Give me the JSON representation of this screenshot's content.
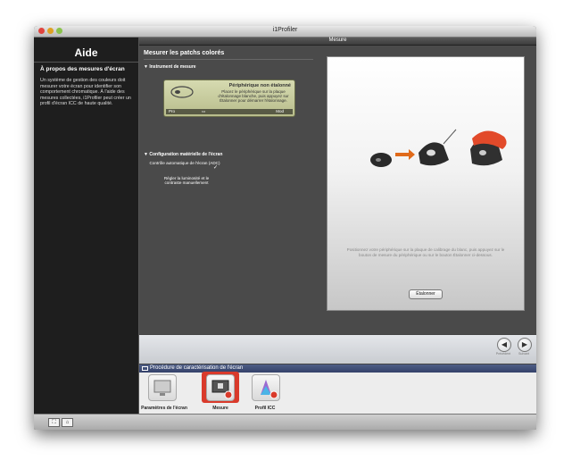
{
  "window": {
    "title": "i1Profiler"
  },
  "sidebar": {
    "title": "Aide",
    "heading": "À propos des mesures d'écran",
    "text": "Un système de gestion des couleurs doit mesurer votre écran pour identifier son comportement chromatique. À l'aide des mesures collectées, i1Profiler peut créer un profil d'écran ICC de haute qualité."
  },
  "main": {
    "header": "Mesure",
    "section_title": "Mesurer les patchs colorés",
    "instrument_heading": "Instrument de mesure",
    "device": {
      "status": "Périphérique non étalonné",
      "description": "Placez le périphérique sur la plaque d'étalonnage blanche, puis appuyez sur Étalonner pour démarrer l'étalonnage.",
      "bar_left": "Pro",
      "bar_right": "Mod"
    },
    "config_heading": "Configuration matérielle de l'écran",
    "adc_label": "Contrôle automatique de l'écran (ADC)",
    "adc_checked": "✓",
    "manual_label": "Régler la luminosité et le contraste manuellement",
    "manual_checked": "",
    "instructions": "Positionnez votre périphérique sur la plaque de calibrage du blanc, puis appuyez sur le bouton de mesure du périphérique ou sur le bouton Étalonner ci-dessous.",
    "calibrate_button": "Étalonner"
  },
  "nav": {
    "prev_label": "Précédent",
    "next_label": "Suivant"
  },
  "procedure": {
    "title": "Procédure de caractérisation de l'écran",
    "steps": [
      {
        "label": "Paramètres de l'écran"
      },
      {
        "label": "Mesure"
      },
      {
        "label": "Profil ICC"
      }
    ]
  },
  "colors": {
    "accent": "#d93a2b",
    "sidebar": "#1e1e1e",
    "procedure_bar": "#3e4c77"
  }
}
